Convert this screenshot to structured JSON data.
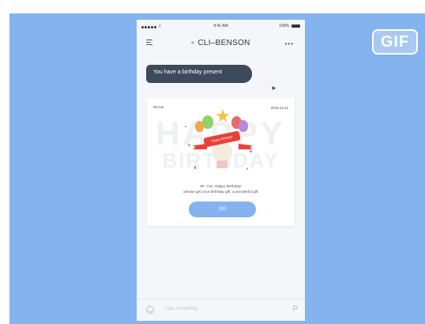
{
  "badge": {
    "label": "GIF"
  },
  "statusbar": {
    "time": "9:41 AM",
    "battery": "100%"
  },
  "header": {
    "title": "CLI–BENSON",
    "more": "•••"
  },
  "chat": {
    "bubble_text": "You have a birthday present"
  },
  "card": {
    "from": "Mr.Car",
    "date": "2018.12.11",
    "bg_line1": "HAPPY",
    "bg_line2": "BIRTHDAY",
    "ribbon_text": "Happy Birthday",
    "message_line1": "Mr. Car, Happy Birthday!",
    "message_line2": "please get your birthday gift, a wonderful gift",
    "go_label": "GO"
  },
  "composer": {
    "placeholder": "Type something"
  },
  "colors": {
    "accent": "#84b3f0",
    "bubble": "#3d4a5c",
    "ribbon": "#e8413a",
    "star": "#f6c33b"
  }
}
